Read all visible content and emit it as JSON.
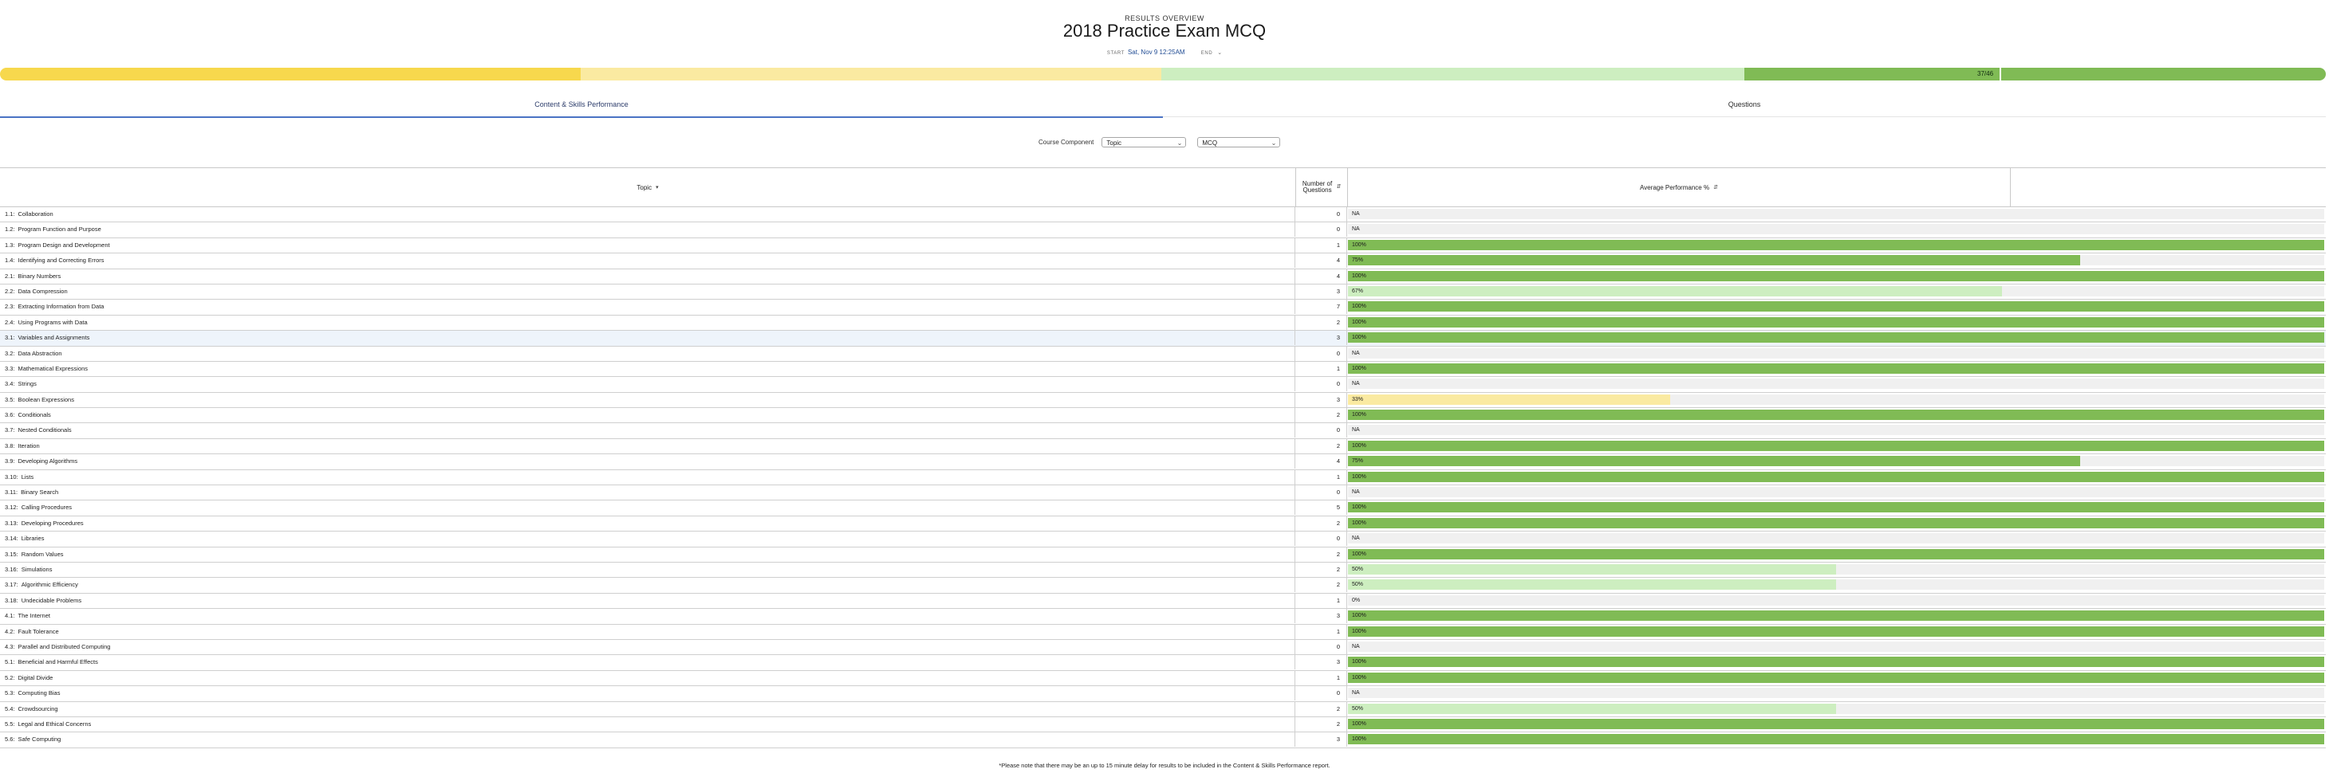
{
  "header": {
    "eyebrow": "RESULTS OVERVIEW",
    "title": "2018 Practice Exam MCQ",
    "start_label": "START",
    "start_value": "Sat, Nov 9 12:25AM",
    "end_label": "END"
  },
  "score": {
    "text": "37/46"
  },
  "tabs": [
    {
      "label": "Content & Skills Performance",
      "active": true
    },
    {
      "label": "Questions",
      "active": false
    }
  ],
  "filters": {
    "label": "Course Component",
    "select1": "Topic",
    "select2": "MCQ"
  },
  "table": {
    "col_topic": "Topic",
    "col_num": "Number of Questions",
    "col_avg": "Average Performance %",
    "rows": [
      {
        "code": "1.1:",
        "name": "Collaboration",
        "num": "0",
        "pct": null,
        "label": "NA"
      },
      {
        "code": "1.2:",
        "name": "Program Function and Purpose",
        "num": "0",
        "pct": null,
        "label": "NA"
      },
      {
        "code": "1.3:",
        "name": "Program Design and Development",
        "num": "1",
        "pct": 100,
        "label": "100%"
      },
      {
        "code": "1.4:",
        "name": "Identifying and Correcting Errors",
        "num": "4",
        "pct": 75,
        "label": "75%"
      },
      {
        "code": "2.1:",
        "name": "Binary Numbers",
        "num": "4",
        "pct": 100,
        "label": "100%"
      },
      {
        "code": "2.2:",
        "name": "Data Compression",
        "num": "3",
        "pct": 67,
        "label": "67%"
      },
      {
        "code": "2.3:",
        "name": "Extracting Information from Data",
        "num": "7",
        "pct": 100,
        "label": "100%"
      },
      {
        "code": "2.4:",
        "name": "Using Programs with Data",
        "num": "2",
        "pct": 100,
        "label": "100%"
      },
      {
        "code": "3.1:",
        "name": "Variables and Assignments",
        "num": "3",
        "pct": 100,
        "label": "100%"
      },
      {
        "code": "3.2:",
        "name": "Data Abstraction",
        "num": "0",
        "pct": null,
        "label": "NA"
      },
      {
        "code": "3.3:",
        "name": "Mathematical Expressions",
        "num": "1",
        "pct": 100,
        "label": "100%"
      },
      {
        "code": "3.4:",
        "name": "Strings",
        "num": "0",
        "pct": null,
        "label": "NA"
      },
      {
        "code": "3.5:",
        "name": "Boolean Expressions",
        "num": "3",
        "pct": 33,
        "label": "33%"
      },
      {
        "code": "3.6:",
        "name": "Conditionals",
        "num": "2",
        "pct": 100,
        "label": "100%"
      },
      {
        "code": "3.7:",
        "name": "Nested Conditionals",
        "num": "0",
        "pct": null,
        "label": "NA"
      },
      {
        "code": "3.8:",
        "name": "Iteration",
        "num": "2",
        "pct": 100,
        "label": "100%"
      },
      {
        "code": "3.9:",
        "name": "Developing Algorithms",
        "num": "4",
        "pct": 75,
        "label": "75%"
      },
      {
        "code": "3.10:",
        "name": "Lists",
        "num": "1",
        "pct": 100,
        "label": "100%"
      },
      {
        "code": "3.11:",
        "name": "Binary Search",
        "num": "0",
        "pct": null,
        "label": "NA"
      },
      {
        "code": "3.12:",
        "name": "Calling Procedures",
        "num": "5",
        "pct": 100,
        "label": "100%"
      },
      {
        "code": "3.13:",
        "name": "Developing Procedures",
        "num": "2",
        "pct": 100,
        "label": "100%"
      },
      {
        "code": "3.14:",
        "name": "Libraries",
        "num": "0",
        "pct": null,
        "label": "NA"
      },
      {
        "code": "3.15:",
        "name": "Random Values",
        "num": "2",
        "pct": 100,
        "label": "100%"
      },
      {
        "code": "3.16:",
        "name": "Simulations",
        "num": "2",
        "pct": 50,
        "label": "50%"
      },
      {
        "code": "3.17:",
        "name": "Algorithmic Efficiency",
        "num": "2",
        "pct": 50,
        "label": "50%"
      },
      {
        "code": "3.18:",
        "name": "Undecidable Problems",
        "num": "1",
        "pct": 0,
        "label": "0%"
      },
      {
        "code": "4.1:",
        "name": "The Internet",
        "num": "3",
        "pct": 100,
        "label": "100%"
      },
      {
        "code": "4.2:",
        "name": "Fault Tolerance",
        "num": "1",
        "pct": 100,
        "label": "100%"
      },
      {
        "code": "4.3:",
        "name": "Parallel and Distributed Computing",
        "num": "0",
        "pct": null,
        "label": "NA"
      },
      {
        "code": "5.1:",
        "name": "Beneficial and Harmful Effects",
        "num": "3",
        "pct": 100,
        "label": "100%"
      },
      {
        "code": "5.2:",
        "name": "Digital Divide",
        "num": "1",
        "pct": 100,
        "label": "100%"
      },
      {
        "code": "5.3:",
        "name": "Computing Bias",
        "num": "0",
        "pct": null,
        "label": "NA"
      },
      {
        "code": "5.4:",
        "name": "Crowdsourcing",
        "num": "2",
        "pct": 50,
        "label": "50%"
      },
      {
        "code": "5.5:",
        "name": "Legal and Ethical Concerns",
        "num": "2",
        "pct": 100,
        "label": "100%"
      },
      {
        "code": "5.6:",
        "name": "Safe Computing",
        "num": "3",
        "pct": 100,
        "label": "100%"
      }
    ]
  },
  "colors": {
    "high": "#80bb55",
    "mid_high": "#cdeec0",
    "mid_low": "#faeaa1",
    "low": "#f7d84d",
    "track": "#f0f0f0",
    "accent": "#4a73c4"
  },
  "footnote": "*Please note that there may be an up to 15 minute delay for results to be included in the Content & Skills Performance report."
}
